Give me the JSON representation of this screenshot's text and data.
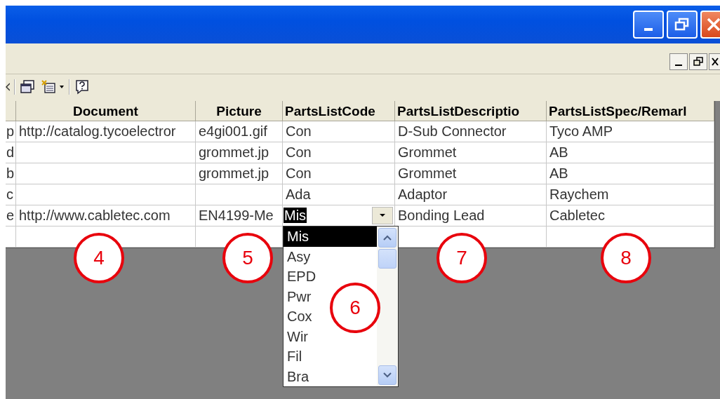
{
  "grid": {
    "columns": [
      {
        "label": "Document"
      },
      {
        "label": "Picture"
      },
      {
        "label": "PartsListCode"
      },
      {
        "label": "PartsListDescriptio"
      },
      {
        "label": "PartsListSpec/Remarl"
      }
    ],
    "rows": [
      {
        "stub": "p",
        "document": "http://catalog.tycoelectror",
        "picture": "e4gi001.gif",
        "code": "Con",
        "description": "D-Sub Connector",
        "spec": "Tyco AMP",
        "editing": false
      },
      {
        "stub": "d",
        "picture": "grommet.jp",
        "code": "Con",
        "description": "Grommet",
        "spec": "AB",
        "editing": false
      },
      {
        "stub": "b",
        "picture": "grommet.jp",
        "code": "Con",
        "description": "Grommet",
        "spec": "AB",
        "editing": false
      },
      {
        "stub": "c",
        "code": "Ada",
        "description": "Adaptor",
        "spec": "Raychem",
        "editing": false
      },
      {
        "stub": "e",
        "document": "http://www.cabletec.com",
        "picture": "EN4199-Me",
        "code": "Mis",
        "description": "Bonding Lead",
        "spec": "Cabletec",
        "editing": true
      }
    ],
    "new_record_row": true,
    "dropdown_options": [
      {
        "label": "Mis",
        "selected": true
      },
      {
        "label": "Asy",
        "selected": false
      },
      {
        "label": "EPD",
        "selected": false
      },
      {
        "label": "Pwr",
        "selected": false
      },
      {
        "label": "Cox",
        "selected": false
      },
      {
        "label": "Wir",
        "selected": false
      },
      {
        "label": "Fil",
        "selected": false
      },
      {
        "label": "Bra",
        "selected": false
      }
    ]
  },
  "annotations": [
    "4",
    "5",
    "6",
    "7",
    "8"
  ]
}
